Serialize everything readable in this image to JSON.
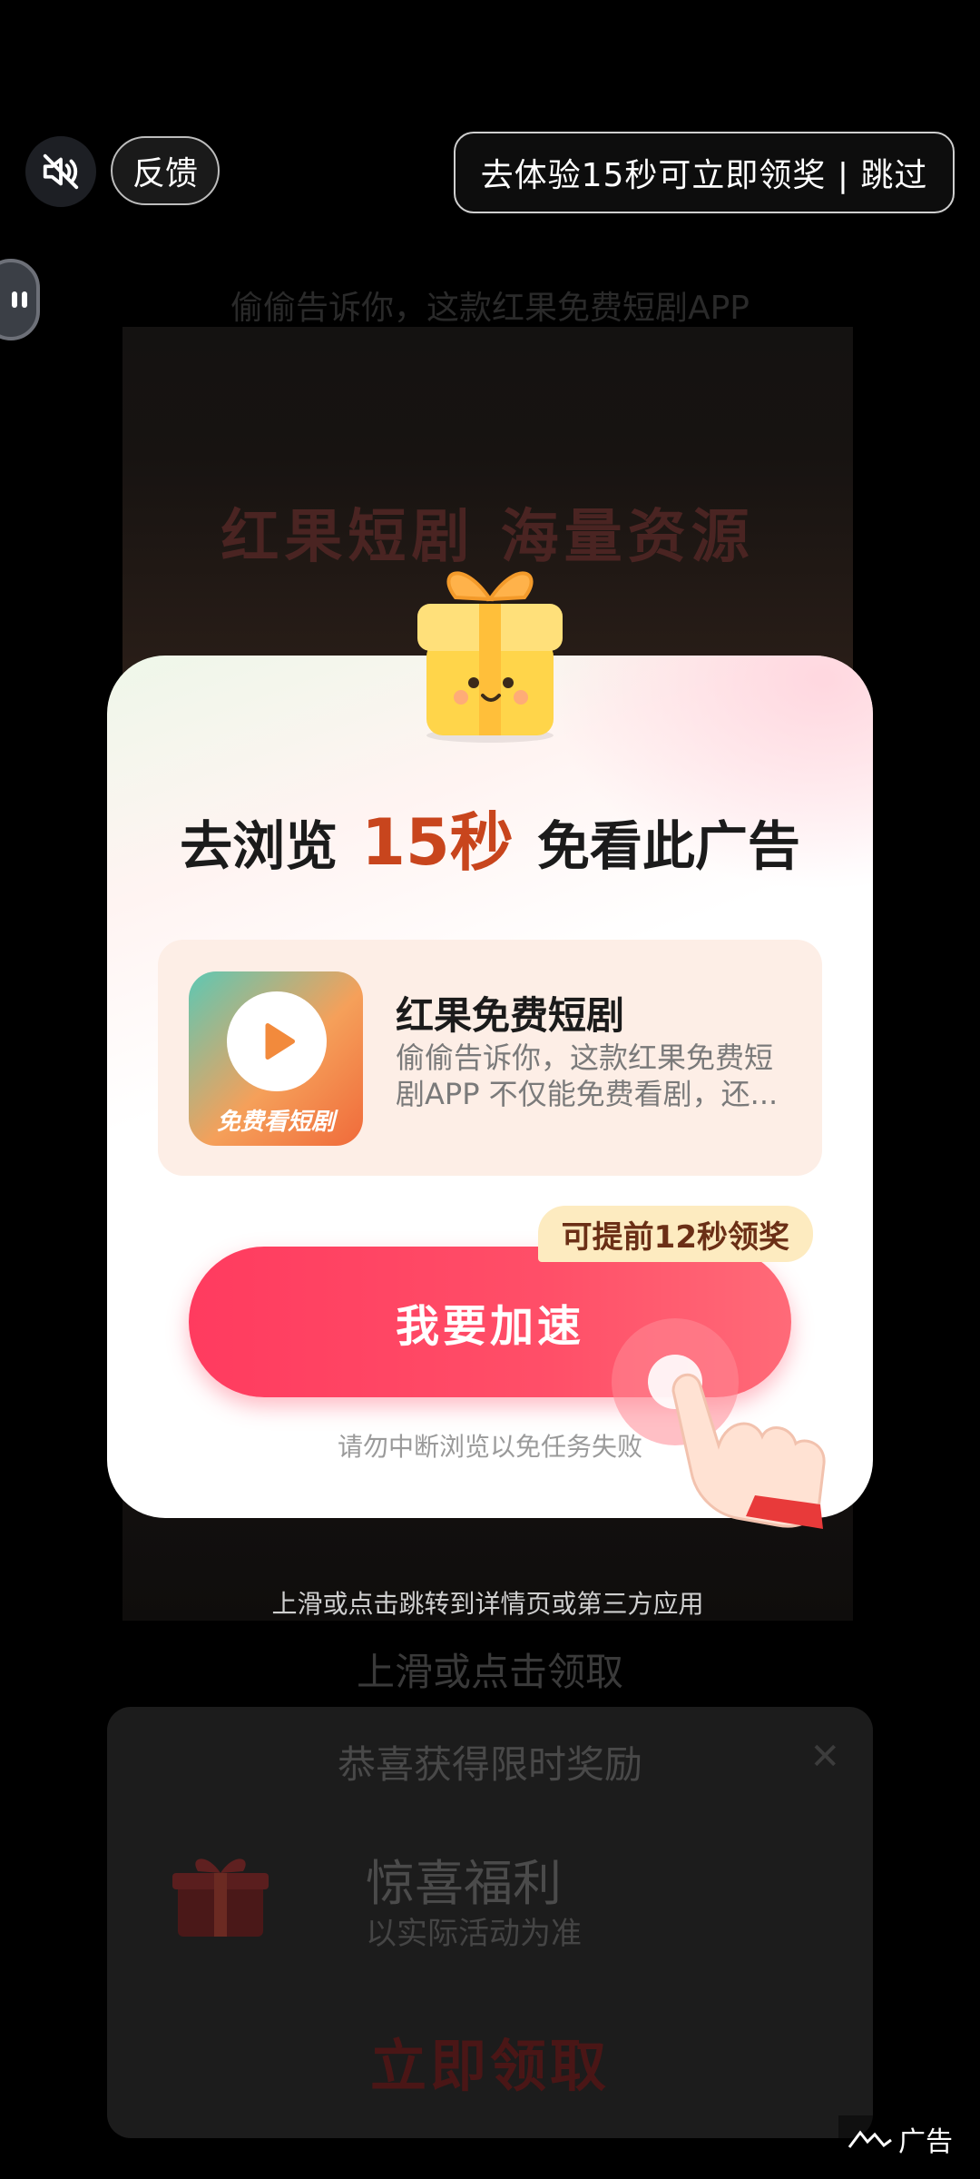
{
  "top_bar": {
    "mute_icon": "speaker-muted-icon",
    "feedback_label": "反馈",
    "skip_label": "去体验15秒可立即领奖 | 跳过"
  },
  "background": {
    "video_caption": "偷偷告诉你，这款红果免费短剧APP",
    "video_headline": "红果短剧 海量资源",
    "video_footer": "上滑或点击跳转到详情页或第三方应用",
    "swipe_hint": "上滑或点击领取"
  },
  "reward_card": {
    "title": "恭喜获得限时奖励",
    "close_icon": "close-icon",
    "name": "惊喜福利",
    "subtitle": "以实际活动为准",
    "claim_label": "立即领取"
  },
  "ad_label": "广告",
  "dialog": {
    "title_prefix": "去浏览",
    "title_highlight": "15秒",
    "title_suffix": "免看此广告",
    "app": {
      "name": "红果免费短剧",
      "description": "偷偷告诉你，这款红果免费短剧APP 不仅能免费看剧，还...",
      "icon_text": "免费看短剧"
    },
    "speed_tag": "可提前12秒领奖",
    "speed_button": "我要加速",
    "note": "请勿中断浏览以免任务失败"
  },
  "colors": {
    "accent_red": "#ff3b5f",
    "highlight_orange": "#c8451d",
    "tag_bg": "#fdebc0"
  }
}
